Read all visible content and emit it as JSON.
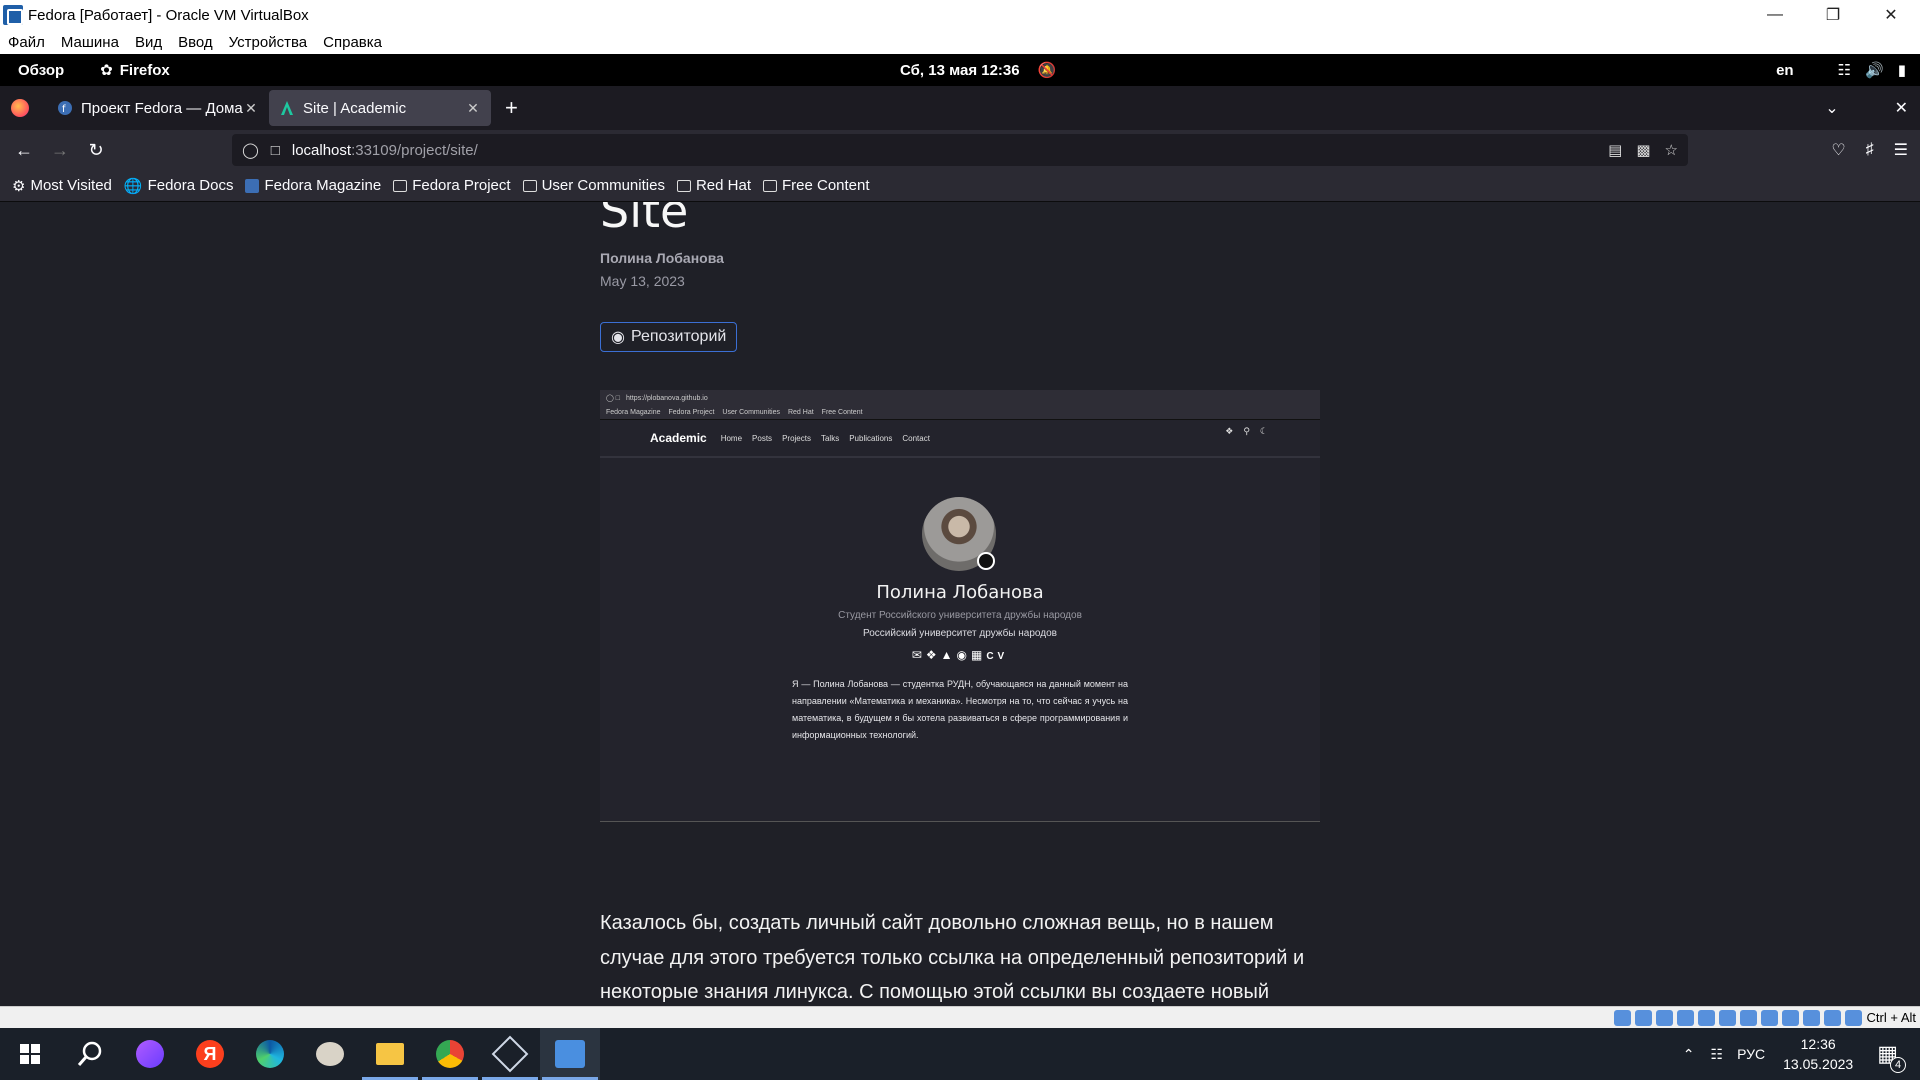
{
  "window": {
    "title": "Fedora [Работает] - Oracle VM VirtualBox",
    "menu": [
      "Файл",
      "Машина",
      "Вид",
      "Ввод",
      "Устройства",
      "Справка"
    ]
  },
  "gnome": {
    "overview": "Обзор",
    "app": "Firefox",
    "clock": "Сб, 13 мая  12:36",
    "lang": "en"
  },
  "browser": {
    "tabs": [
      {
        "title": "Проект Fedora — Домашняя"
      },
      {
        "title": "Site | Academic"
      }
    ],
    "url_host": "localhost",
    "url_path": ":33109/project/site/",
    "bookmarks": [
      "Most Visited",
      "Fedora Docs",
      "Fedora Magazine",
      "Fedora Project",
      "User Communities",
      "Red Hat",
      "Free Content"
    ]
  },
  "page": {
    "title": "Site",
    "author": "Полина Лобанова",
    "date": "May 13, 2023",
    "repo_button": "Репозиторий",
    "paragraph": "Казалось бы, создать личный сайт довольно сложная вещь, но в нашем случае для этого требуется только ссылка на определенный репозиторий и некоторые знания линукса. С помощью этой ссылки вы создаете новый репозиторий и все необходимые файлы для сайта. После вам нужно будет создать еще один репозиторий для того, чтобы"
  },
  "preview": {
    "url": "https://plobanova.github.io",
    "bookmarks": [
      "Fedora Magazine",
      "Fedora Project",
      "User Communities",
      "Red Hat",
      "Free Content"
    ],
    "brand": "Academic",
    "nav": [
      "Home",
      "Posts",
      "Projects",
      "Talks",
      "Publications",
      "Contact"
    ],
    "name": "Полина Лобанова",
    "role": "Студент Российского университета дружбы народов",
    "org": "Российский университет дружбы народов",
    "social_cv": "CV",
    "bio": "Я — Полина Лобанова — студентка РУДН, обучающаяся на данный момент на направлении «Математика и механика». Несмотря на то, что сейчас я учусь на математика, в будущем я бы хотела развиваться в сфере программирования и информационных технологий."
  },
  "statusbar": {
    "hostkey": "Ctrl + Alt"
  },
  "taskbar": {
    "lang": "РУС",
    "time": "12:36",
    "date": "13.05.2023",
    "notifications": "4"
  }
}
